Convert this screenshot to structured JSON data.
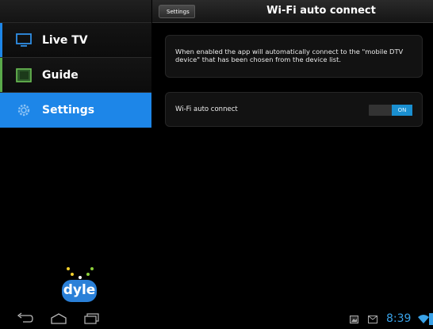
{
  "window": {
    "title": "Wi-Fi auto connect"
  },
  "header": {
    "back_label": "Settings",
    "title": "Wi-Fi auto connect"
  },
  "sidebar": {
    "items": [
      {
        "label": "Live TV",
        "icon": "tv-icon",
        "selected": false
      },
      {
        "label": "Guide",
        "icon": "guide-icon",
        "selected": false
      },
      {
        "label": "Settings",
        "icon": "gear-icon",
        "selected": true
      }
    ],
    "logo_text": "dyle"
  },
  "main": {
    "description": "When enabled the app will automatically connect to the \"mobile DTV device\" that has been chosen from the device list.",
    "setting_label": "Wi-Fi auto connect",
    "toggle_label": "ON",
    "toggle_state": true
  },
  "status_bar": {
    "time": "8:39"
  },
  "colors": {
    "accent": "#1d86e8",
    "toggle_on": "#1a8fd0",
    "time": "#39a2e8",
    "background": "#000000"
  }
}
